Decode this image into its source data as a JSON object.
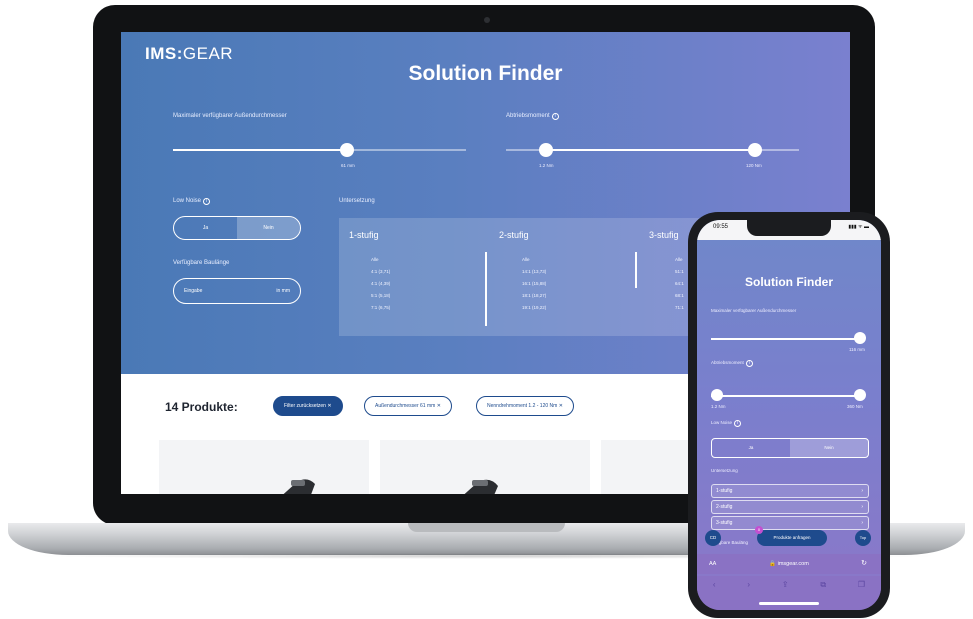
{
  "laptop": {
    "logo_bold": "IMS",
    "logo_sep": ":",
    "logo_rest": "GEAR",
    "title": "Solution Finder",
    "diameter_label": "Maximaler verfügbarer Außendurchmesser",
    "diameter_value": "61 mm",
    "torque_label": "Abtriebsmoment",
    "torque_min": "1.2 Nm",
    "torque_max": "120 Nm",
    "lownoise_label": "Low Noise",
    "toggle_yes": "Ja",
    "toggle_no": "Nein",
    "length_label": "Verfügbare Baulänge",
    "length_placeholder": "Eingabe",
    "length_unit": "in mm",
    "ratio_label": "Untersetzung",
    "ratio_columns": [
      {
        "head": "1-stufig",
        "items": [
          "Alle",
          "4:1 (3,71)",
          "4:1 (4,39)",
          "5:1 (5,18)",
          "7:1 (6,75)"
        ]
      },
      {
        "head": "2-stufig",
        "items": [
          "Alle",
          "14:1 (13,73)",
          "16:1 (15,88)",
          "18:1 (18,27)",
          "19:1 (19,22)"
        ]
      },
      {
        "head": "3-stufig",
        "items": [
          "Alle",
          "51:1",
          "64:1",
          "68:1",
          "71:1"
        ]
      }
    ],
    "products_count": "14 Produkte:",
    "chips": [
      "Filter zurücksetzen ✕",
      "Außendurchmesser 61 mm ✕",
      "Nenndrehmoment 1.2 - 120 Nm ✕"
    ]
  },
  "phone": {
    "time": "09:55",
    "status_icons": "▮▮▮ ᯤ ▬",
    "title": "Solution Finder",
    "diameter_label": "Maximaler verfügbarer Außendurchmesser",
    "diameter_value": "116 mm",
    "torque_label": "Abtriebsmoment",
    "torque_min": "1.2 Nm",
    "torque_max": "360 Nm",
    "lownoise_label": "Low Noise",
    "toggle_yes": "Ja",
    "toggle_no": "Nein",
    "ratio_label": "Untersetzung",
    "ratio_rows": [
      "1-stufig",
      "2-stufig",
      "3-stufig"
    ],
    "length_label_partial": "erfügbare Bauläng",
    "cta": "Produkte anfragen",
    "cta_badge": "0",
    "left_button": "CD",
    "right_button": "Top",
    "url_aa": "AA",
    "url": "🔒 imsgear.com",
    "reload": "↻",
    "nav": [
      "‹",
      "›",
      "⇪",
      "⧉",
      "❐"
    ]
  }
}
